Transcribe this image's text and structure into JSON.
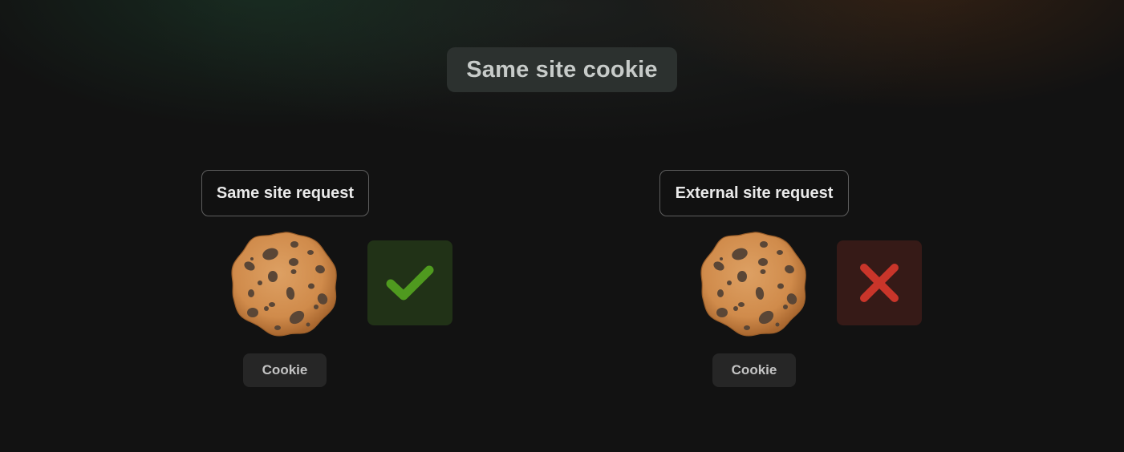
{
  "title": "Same site cookie",
  "panels": [
    {
      "request_label": "Same site request",
      "cookie_label": "Cookie",
      "status_icon": "checkmark-icon",
      "status_color": "#4f9a1f",
      "status_background": "#213217"
    },
    {
      "request_label": "External site request",
      "cookie_label": "Cookie",
      "status_icon": "cross-icon",
      "status_color": "#c9352a",
      "status_background": "#361a17"
    }
  ],
  "cookie_icon": "cookie-icon",
  "colors": {
    "background": "#121212",
    "title_badge": "#2c312f",
    "cookie_dough": "#d3904f",
    "chocolate_chip": "#5a4636"
  }
}
